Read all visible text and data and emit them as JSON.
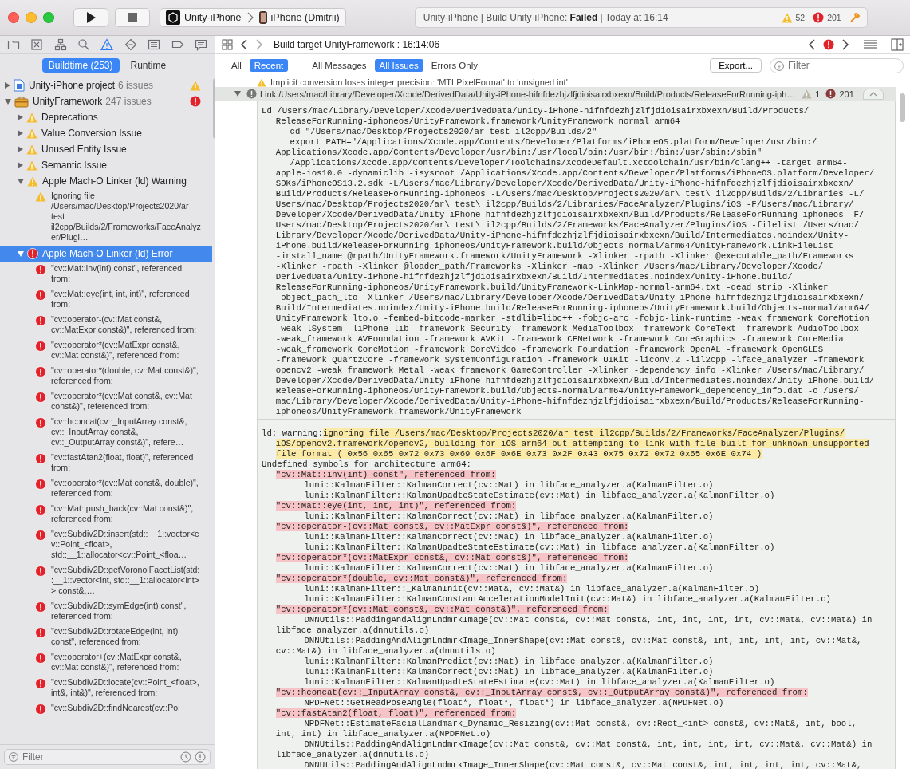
{
  "toolbar": {
    "scheme": {
      "target": "Unity-iPhone",
      "device": "iPhone (Dmitrii)"
    },
    "activity": {
      "status": "Unity-iPhone | Build Unity-iPhone: **Failed** | Today at 16:14",
      "warnings": "52",
      "errors": "201"
    }
  },
  "navigator": {
    "icons": [
      {
        "selected": false
      },
      {
        "selected": false
      },
      {
        "selected": false
      },
      {
        "selected": false
      },
      {
        "selected": true
      },
      {
        "selected": false
      },
      {
        "selected": false
      },
      {
        "selected": false
      },
      {
        "selected": false
      }
    ],
    "tabs": [
      {
        "label": "Buildtime (253)",
        "selected": true
      },
      {
        "label": "Runtime",
        "selected": false
      }
    ],
    "tree": [
      {
        "kind": "project",
        "label": "Unity-iPhone project",
        "count": "6 issues",
        "error": false,
        "expanded": false,
        "selected": false
      },
      {
        "kind": "target",
        "label": "UnityFramework",
        "count": "247 issues",
        "error": true,
        "expanded": true,
        "selected": false,
        "children": [
          {
            "kind": "group",
            "label": "Deprecations",
            "error": false,
            "expanded": false,
            "selected": false
          },
          {
            "kind": "group",
            "label": "Value Conversion Issue",
            "error": false,
            "expanded": false,
            "selected": false
          },
          {
            "kind": "group",
            "label": "Unused Entity Issue",
            "error": false,
            "expanded": false,
            "selected": false
          },
          {
            "kind": "group",
            "label": "Semantic Issue",
            "error": false,
            "expanded": false,
            "selected": false
          },
          {
            "kind": "group",
            "label": "Apple Mach-O Linker (ld) Warning",
            "error": false,
            "expanded": true,
            "selected": false,
            "children": [
              {
                "kind": "issue",
                "label": "Ignoring file /Users/mac/Desktop/Projects2020/ar test il2cpp/Builds/2/Frameworks/FaceAnalyzer/Plugi…",
                "error": false,
                "selected": false
              }
            ]
          },
          {
            "kind": "group",
            "label": "Apple Mach-O Linker (ld) Error",
            "error": true,
            "expanded": true,
            "selected": true,
            "children": [
              {
                "kind": "issue",
                "label": "\"cv::Mat::inv(int) const\", referenced from:",
                "error": true,
                "selected": false
              },
              {
                "kind": "issue",
                "label": "\"cv::Mat::eye(int, int, int)\", referenced from:",
                "error": true,
                "selected": false
              },
              {
                "kind": "issue",
                "label": "\"cv::operator-(cv::Mat const&, cv::MatExpr const&)\", referenced from:",
                "error": true,
                "selected": false
              },
              {
                "kind": "issue",
                "label": "\"cv::operator*(cv::MatExpr const&, cv::Mat const&)\", referenced from:",
                "error": true,
                "selected": false
              },
              {
                "kind": "issue",
                "label": "\"cv::operator*(double, cv::Mat const&)\", referenced from:",
                "error": true,
                "selected": false
              },
              {
                "kind": "issue",
                "label": "\"cv::operator*(cv::Mat const&, cv::Mat const&)\", referenced from:",
                "error": true,
                "selected": false
              },
              {
                "kind": "issue",
                "label": "\"cv::hconcat(cv::_InputArray const&, cv::_InputArray const&, cv::_OutputArray const&)\", refere…",
                "error": true,
                "selected": false
              },
              {
                "kind": "issue",
                "label": "\"cv::fastAtan2(float, float)\", referenced from:",
                "error": true,
                "selected": false
              },
              {
                "kind": "issue",
                "label": "\"cv::operator*(cv::Mat const&, double)\", referenced from:",
                "error": true,
                "selected": false
              },
              {
                "kind": "issue",
                "label": "\"cv::Mat::push_back(cv::Mat const&)\", referenced from:",
                "error": true,
                "selected": false
              },
              {
                "kind": "issue",
                "label": "\"cv::Subdiv2D::insert(std::__1::vector<cv::Point_<float>, std::__1::allocator<cv::Point_<floa…",
                "error": true,
                "selected": false
              },
              {
                "kind": "issue",
                "label": "\"cv::Subdiv2D::getVoronoiFacetList(std::__1::vector<int, std::__1::allocator<int> > const&,…",
                "error": true,
                "selected": false
              },
              {
                "kind": "issue",
                "label": "\"cv::Subdiv2D::symEdge(int) const\", referenced from:",
                "error": true,
                "selected": false
              },
              {
                "kind": "issue",
                "label": "\"cv::Subdiv2D::rotateEdge(int, int) const\", referenced from:",
                "error": true,
                "selected": false
              },
              {
                "kind": "issue",
                "label": "\"cv::operator+(cv::MatExpr const&, cv::Mat const&)\", referenced from:",
                "error": true,
                "selected": false
              },
              {
                "kind": "issue",
                "label": "\"cv::Subdiv2D::locate(cv::Point_<float>, int&, int&)\", referenced from:",
                "error": true,
                "selected": false
              },
              {
                "kind": "issue",
                "label": "\"cv::Subdiv2D::findNearest(cv::Poi",
                "error": true,
                "selected": false
              }
            ]
          }
        ]
      }
    ],
    "filter": {
      "placeholder": "Filter"
    }
  },
  "editor": {
    "jump_bar": {
      "title": "Build target UnityFramework : 16:14:06"
    },
    "scope_filters": [
      {
        "label": "All",
        "selected": false
      },
      {
        "label": "Recent",
        "selected": true
      }
    ],
    "message_filters": [
      {
        "label": "All Messages",
        "selected": false
      },
      {
        "label": "All Issues",
        "selected": true
      },
      {
        "label": "Errors Only",
        "selected": false
      }
    ],
    "export_button": "Export...",
    "filter": {
      "placeholder": "Filter"
    }
  },
  "log": {
    "previous_entry": "Implicit conversion loses integer precision: 'MTLPixelFormat' to 'unsigned int'",
    "link_step": {
      "text": "Link /Users/mac/Library/Developer/Xcode/DerivedData/Unity-iPhone-hifnfdezhjzlfjdioisairxbxexn/Build/Products/ReleaseForRunning-iph…",
      "expanded": true,
      "warnings": "1",
      "errors": "201"
    },
    "blocks": [
      {
        "lines": [
          {
            "kind": "head",
            "text": "Ld /Users/mac/Library/Developer/Xcode/DerivedData/Unity-iPhone-hifnfdezhjzlfjdioisairxbxexn/Build/Products/"
          },
          {
            "kind": "cont",
            "text": "ReleaseForRunning-iphoneos/UnityFramework.framework/UnityFramework normal arm64"
          },
          {
            "kind": "sub",
            "text": "cd \"/Users/mac/Desktop/Projects2020/ar test il2cpp/Builds/2\""
          },
          {
            "kind": "sub",
            "text": "export PATH=\"/Applications/Xcode.app/Contents/Developer/Platforms/iPhoneOS.platform/Developer/usr/bin:/"
          },
          {
            "kind": "cont",
            "text": "Applications/Xcode.app/Contents/Developer/usr/bin:/usr/local/bin:/usr/bin:/bin:/usr/sbin:/sbin\""
          },
          {
            "kind": "sub",
            "text": "/Applications/Xcode.app/Contents/Developer/Toolchains/XcodeDefault.xctoolchain/usr/bin/clang++ -target arm64-"
          },
          {
            "kind": "cont",
            "text": "apple-ios10.0 -dynamiclib -isysroot /Applications/Xcode.app/Contents/Developer/Platforms/iPhoneOS.platform/Developer/"
          },
          {
            "kind": "cont",
            "text": "SDKs/iPhoneOS13.2.sdk -L/Users/mac/Library/Developer/Xcode/DerivedData/Unity-iPhone-hifnfdezhjzlfjdioisairxbxexn/"
          },
          {
            "kind": "cont",
            "text": "Build/Products/ReleaseForRunning-iphoneos -L/Users/mac/Desktop/Projects2020/ar\\ test\\ il2cpp/Builds/2/Libraries -L/"
          },
          {
            "kind": "cont",
            "text": "Users/mac/Desktop/Projects2020/ar\\ test\\ il2cpp/Builds/2/Libraries/FaceAnalyzer/Plugins/iOS -F/Users/mac/Library/"
          },
          {
            "kind": "cont",
            "text": "Developer/Xcode/DerivedData/Unity-iPhone-hifnfdezhjzlfjdioisairxbxexn/Build/Products/ReleaseForRunning-iphoneos -F/"
          },
          {
            "kind": "cont",
            "text": "Users/mac/Desktop/Projects2020/ar\\ test\\ il2cpp/Builds/2/Frameworks/FaceAnalyzer/Plugins/iOS -filelist /Users/mac/"
          },
          {
            "kind": "cont",
            "text": "Library/Developer/Xcode/DerivedData/Unity-iPhone-hifnfdezhjzlfjdioisairxbxexn/Build/Intermediates.noindex/Unity-"
          },
          {
            "kind": "cont",
            "text": "iPhone.build/ReleaseForRunning-iphoneos/UnityFramework.build/Objects-normal/arm64/UnityFramework.LinkFileList"
          },
          {
            "kind": "cont",
            "text": "-install_name @rpath/UnityFramework.framework/UnityFramework -Xlinker -rpath -Xlinker @executable_path/Frameworks"
          },
          {
            "kind": "cont",
            "text": "-Xlinker -rpath -Xlinker @loader_path/Frameworks -Xlinker -map -Xlinker /Users/mac/Library/Developer/Xcode/"
          },
          {
            "kind": "cont",
            "text": "DerivedData/Unity-iPhone-hifnfdezhjzlfjdioisairxbxexn/Build/Intermediates.noindex/Unity-iPhone.build/"
          },
          {
            "kind": "cont",
            "text": "ReleaseForRunning-iphoneos/UnityFramework.build/UnityFramework-LinkMap-normal-arm64.txt -dead_strip -Xlinker"
          },
          {
            "kind": "cont",
            "text": "-object_path_lto -Xlinker /Users/mac/Library/Developer/Xcode/DerivedData/Unity-iPhone-hifnfdezhjzlfjdioisairxbxexn/"
          },
          {
            "kind": "cont",
            "text": "Build/Intermediates.noindex/Unity-iPhone.build/ReleaseForRunning-iphoneos/UnityFramework.build/Objects-normal/arm64/"
          },
          {
            "kind": "cont",
            "text": "UnityFramework_lto.o -fembed-bitcode-marker -stdlib=libc++ -fobjc-arc -fobjc-link-runtime -weak_framework CoreMotion"
          },
          {
            "kind": "cont",
            "text": "-weak-lSystem -liPhone-lib -framework Security -framework MediaToolbox -framework CoreText -framework AudioToolbox"
          },
          {
            "kind": "cont",
            "text": "-weak_framework AVFoundation -framework AVKit -framework CFNetwork -framework CoreGraphics -framework CoreMedia"
          },
          {
            "kind": "cont",
            "text": "-weak_framework CoreMotion -framework CoreVideo -framework Foundation -framework OpenAL -framework OpenGLES"
          },
          {
            "kind": "cont",
            "text": "-framework QuartzCore -framework SystemConfiguration -framework UIKit -liconv.2 -lil2cpp -lface_analyzer -framework"
          },
          {
            "kind": "cont",
            "text": "opencv2 -weak_framework Metal -weak_framework GameController -Xlinker -dependency_info -Xlinker /Users/mac/Library/"
          },
          {
            "kind": "cont",
            "text": "Developer/Xcode/DerivedData/Unity-iPhone-hifnfdezhjzlfjdioisairxbxexn/Build/Intermediates.noindex/Unity-iPhone.build/"
          },
          {
            "kind": "cont",
            "text": "ReleaseForRunning-iphoneos/UnityFramework.build/Objects-normal/arm64/UnityFramework_dependency_info.dat -o /Users/"
          },
          {
            "kind": "cont",
            "text": "mac/Library/Developer/Xcode/DerivedData/Unity-iPhone-hifnfdezhjzlfjdioisairxbxexn/Build/Products/ReleaseForRunning-"
          },
          {
            "kind": "cont",
            "text": "iphoneos/UnityFramework.framework/UnityFramework"
          }
        ]
      },
      {
        "lines": [
          {
            "kind": "warning_head",
            "prefix": "ld: warning:",
            "text": "ignoring file /Users/mac/Desktop/Projects2020/ar test il2cpp/Builds/2/Frameworks/FaceAnalyzer/Plugins/"
          },
          {
            "kind": "warning",
            "text": "iOS/opencv2.framework/opencv2, building for iOS-arm64 but attempting to link with file built for unknown-unsupported"
          },
          {
            "kind": "warning",
            "text": "file format ( 0x56 0x65 0x72 0x73 0x69 0x6F 0x6E 0x73 0x2F 0x43 0x75 0x72 0x72 0x65 0x6E 0x74 )"
          },
          {
            "kind": "head",
            "text": "Undefined symbols for architecture arm64:"
          },
          {
            "kind": "symbol",
            "text": "\"cv::Mat::inv(int) const\", referenced from:"
          },
          {
            "kind": "ref",
            "text": "luni::KalmanFilter::KalmanCorrect(cv::Mat) in libface_analyzer.a(KalmanFilter.o)"
          },
          {
            "kind": "ref",
            "text": "luni::KalmanFilter::KalmanUpadteStateEstimate(cv::Mat) in libface_analyzer.a(KalmanFilter.o)"
          },
          {
            "kind": "symbol",
            "text": "\"cv::Mat::eye(int, int, int)\", referenced from:"
          },
          {
            "kind": "ref",
            "text": "luni::KalmanFilter::KalmanCorrect(cv::Mat) in libface_analyzer.a(KalmanFilter.o)"
          },
          {
            "kind": "symbol",
            "text": "\"cv::operator-(cv::Mat const&, cv::MatExpr const&)\", referenced from:"
          },
          {
            "kind": "ref",
            "text": "luni::KalmanFilter::KalmanCorrect(cv::Mat) in libface_analyzer.a(KalmanFilter.o)"
          },
          {
            "kind": "ref",
            "text": "luni::KalmanFilter::KalmanUpadteStateEstimate(cv::Mat) in libface_analyzer.a(KalmanFilter.o)"
          },
          {
            "kind": "symbol",
            "text": "\"cv::operator*(cv::MatExpr const&, cv::Mat const&)\", referenced from:"
          },
          {
            "kind": "ref",
            "text": "luni::KalmanFilter::KalmanCorrect(cv::Mat) in libface_analyzer.a(KalmanFilter.o)"
          },
          {
            "kind": "symbol",
            "text": "\"cv::operator*(double, cv::Mat const&)\", referenced from:"
          },
          {
            "kind": "ref",
            "text": "luni::KalmanFilter::_KalmanInit(cv::Mat&, cv::Mat&) in libface_analyzer.a(KalmanFilter.o)"
          },
          {
            "kind": "ref",
            "text": "luni::KalmanFilter::KalmanConstantAccelerationModelInit(cv::Mat&) in libface_analyzer.a(KalmanFilter.o)"
          },
          {
            "kind": "symbol",
            "text": "\"cv::operator*(cv::Mat const&, cv::Mat const&)\", referenced from:"
          },
          {
            "kind": "ref",
            "text": "DNNUtils::PaddingAndAlignLndmrkImage(cv::Mat const&, cv::Mat const&, int, int, int, int, cv::Mat&, cv::Mat&) in"
          },
          {
            "kind": "cont",
            "text": "libface_analyzer.a(dnnutils.o)"
          },
          {
            "kind": "ref",
            "text": "DNNUtils::PaddingAndAlignLndmrkImage_InnerShape(cv::Mat const&, cv::Mat const&, int, int, int, int, cv::Mat&,"
          },
          {
            "kind": "cont",
            "text": "cv::Mat&) in libface_analyzer.a(dnnutils.o)"
          },
          {
            "kind": "ref",
            "text": "luni::KalmanFilter::KalmanPredict(cv::Mat) in libface_analyzer.a(KalmanFilter.o)"
          },
          {
            "kind": "ref",
            "text": "luni::KalmanFilter::KalmanCorrect(cv::Mat) in libface_analyzer.a(KalmanFilter.o)"
          },
          {
            "kind": "ref",
            "text": "luni::KalmanFilter::KalmanUpadteStateEstimate(cv::Mat) in libface_analyzer.a(KalmanFilter.o)"
          },
          {
            "kind": "symbol",
            "text": "\"cv::hconcat(cv::_InputArray const&, cv::_InputArray const&, cv::_OutputArray const&)\", referenced from:"
          },
          {
            "kind": "ref",
            "text": "NPDFNet::GetHeadPoseAngle(float*, float*, float*) in libface_analyzer.a(NPDFNet.o)"
          },
          {
            "kind": "symbol",
            "text": "\"cv::fastAtan2(float, float)\", referenced from:"
          },
          {
            "kind": "ref",
            "text": "NPDFNet::EstimateFacialLandmark_Dynamic_Resizing(cv::Mat const&, cv::Rect_<int> const&, cv::Mat&, int, bool,"
          },
          {
            "kind": "cont",
            "text": "int, int) in libface_analyzer.a(NPDFNet.o)"
          },
          {
            "kind": "ref",
            "text": "DNNUtils::PaddingAndAlignLndmrkImage(cv::Mat const&, cv::Mat const&, int, int, int, int, cv::Mat&, cv::Mat&) in"
          },
          {
            "kind": "cont",
            "text": "libface_analyzer.a(dnnutils.o)"
          },
          {
            "kind": "ref",
            "text": "DNNUtils::PaddingAndAlignLndmrkImage_InnerShape(cv::Mat const&, cv::Mat const&, int, int, int, int, cv::Mat&,"
          }
        ]
      }
    ]
  }
}
